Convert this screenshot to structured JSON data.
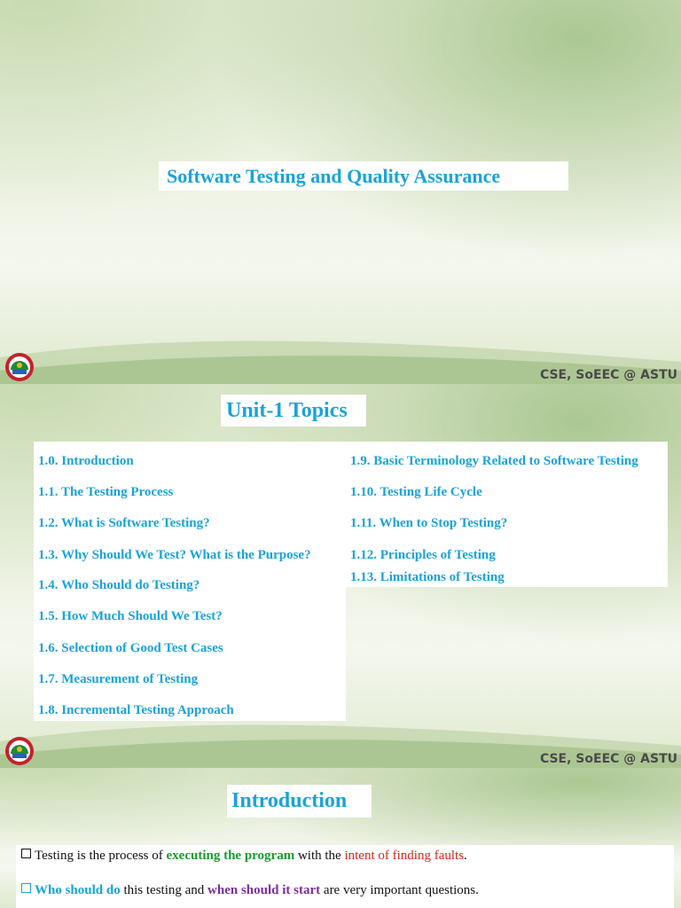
{
  "slide1": {
    "title": "Software Testing and Quality Assurance",
    "footer": "CSE, SoEEC @ ASTU"
  },
  "slide2": {
    "title": "Unit-1 Topics",
    "left_topics": [
      "1.0. Introduction",
      "1.1. The Testing Process",
      "1.2. What is Software Testing?",
      "1.3. Why Should We Test? What is the Purpose?",
      "1.4. Who Should do Testing?",
      "1.5. How Much Should We Test?",
      "1.6. Selection of Good Test Cases",
      "1.7. Measurement of Testing",
      "1.8. Incremental Testing Approach"
    ],
    "right_topics": [
      "1.9. Basic Terminology Related to Software Testing",
      "1.10. Testing Life Cycle",
      "1.11. When to Stop Testing?",
      "1.12. Principles of Testing",
      "1.13. Limitations of Testing"
    ],
    "footer": "CSE, SoEEC @ ASTU"
  },
  "slide3": {
    "title": "Introduction",
    "bullet1": {
      "p1": "Testing is the process of ",
      "p2": "executing the program",
      "p3": " with the ",
      "p4": "intent of finding faults",
      "p5": "."
    },
    "bullet2": {
      "p1": "Who should do",
      "p2": " this testing and ",
      "p3": "when should it start",
      "p4": " are very  important questions."
    }
  },
  "colors": {
    "title_blue": "#1aa3d9",
    "green": "#1a9a2e",
    "red": "#e0221a",
    "purple": "#7a2ea0"
  },
  "icons": {
    "logo": "university-seal-icon",
    "bullet": "square-bullet-icon"
  }
}
